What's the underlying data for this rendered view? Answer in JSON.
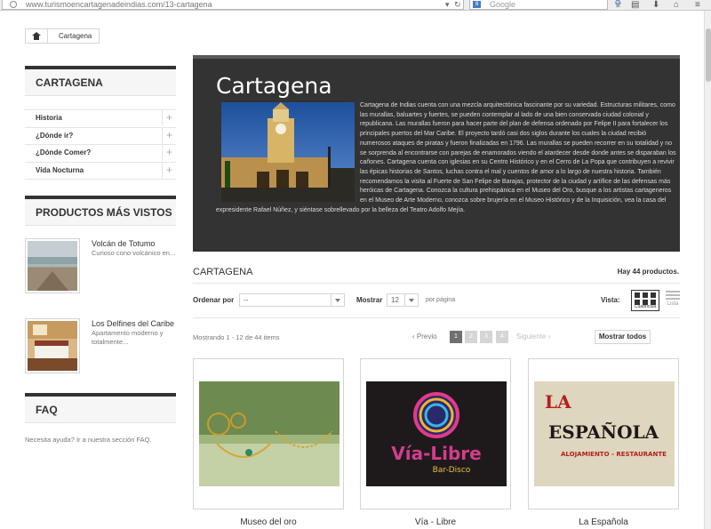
{
  "browser": {
    "url": "www.turismoencartagenadeindias.com/13-cartagena",
    "search_engine_badge": "8",
    "search_placeholder": "Google"
  },
  "breadcrumb": {
    "current": "Cartagena"
  },
  "sidebar": {
    "categories_title": "CARTAGENA",
    "categories": [
      {
        "label": "Historia"
      },
      {
        "label": "¿Dónde ir?"
      },
      {
        "label": "¿Dónde Comer?"
      },
      {
        "label": "Vida Nocturna"
      }
    ],
    "viewed_title": "PRODUCTOS MÁS VISTOS",
    "viewed": [
      {
        "name": "Volcán de Totumo",
        "desc": "Curioso cono volcánico en..."
      },
      {
        "name": "Los Delfines del Caribe",
        "desc": "Apartamento moderno y totalmente..."
      }
    ],
    "faq_title": "FAQ",
    "faq_text": "Necesita ayuda? Ir a nuestra sección FAQ."
  },
  "banner": {
    "title": "Cartagena",
    "text": "Cartagena de Indias cuenta con una mezcla arquitectónica fascinante por su variedad. Estructuras militares, como las murallas, baluartes y fuertes, se pueden contemplar al lado de una bien conservada ciudad colonial y republicana. Las murallas fueron para hacer parte del plan de defensa ordenado por Felipe II para fortalecer los principales puertos del Mar Caribe. El proyecto tardó casi dos siglos durante los cuales la ciudad recibió numerosos ataques de piratas y fueron finalizadas en 1796. Las murallas se pueden recorrer en su totalidad y no se sorprenda al encontrarse con parejas de enamorados viendo el atardecer desde donde antes se disparaban los cañones. Cartagena cuenta con iglesias en su Centro Histórico y en el Cerro de La Popa que contribuyen a revivir las épicas historias de Santos, luchas contra el mal y cuentos de amor a lo largo de nuestra historia. También recomendamos la visita al Fuerte de San Felipe de Barajas, protector de la ciudad y artífice de las defensas más heróicas de Cartagena. Conozca la cultura prehispánica en el Museo del Oro, busque a los artistas cartageneros en el Museo de Arte Moderno, conozca sobre brujería en el Museo Histórico y de la Inquisición, vea la casa del expresidente Rafael Núñez, y siéntase sobrellevado por la belleza del Teatro Adolfo Mejía."
  },
  "listing": {
    "heading": "CARTAGENA",
    "count": "Hay 44 productos.",
    "sort_label": "Ordenar por",
    "sort_value": "--",
    "show_label": "Mostrar",
    "show_value": "12",
    "per_page": "por página",
    "view_label": "Vista:",
    "view_grid": "Cuadrícula",
    "view_list": "Lista",
    "showing": "Mostrando 1 - 12 de 44 items",
    "prev": "Previo",
    "next": "Siguiente",
    "pages": [
      "1",
      "2",
      "3",
      "4"
    ],
    "show_all": "Mostrar todos"
  },
  "products": [
    {
      "name": "Museo del oro"
    },
    {
      "name": "Vía - Libre"
    },
    {
      "name": "La Española"
    }
  ],
  "product_image_text": {
    "vialibre_title": "Vía-Libre",
    "vialibre_sub": "Bar-Disco",
    "espanola_la": "LA",
    "espanola_title": "ESPAÑOLA",
    "espanola_sub": "ALOJAMIENTO - RESTAURANTE"
  },
  "colors": {
    "banner_bg": "#333333",
    "border": "#d6d4d4",
    "active_page": "#6f6f6f"
  }
}
